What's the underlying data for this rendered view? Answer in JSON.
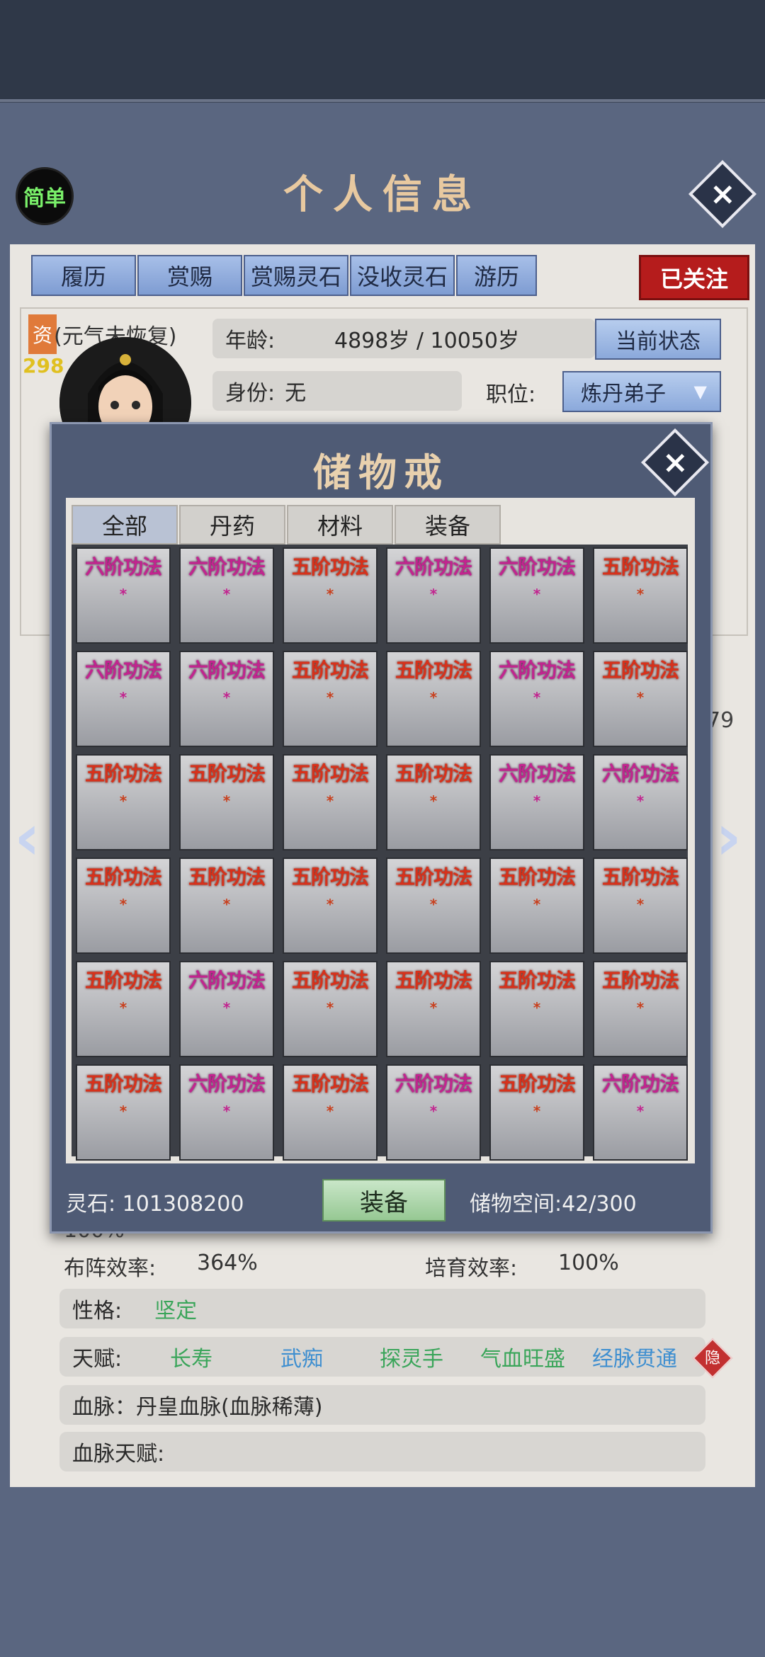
{
  "header": {
    "title": "个人信息",
    "simple_label": "简单"
  },
  "tabs": [
    "履历",
    "赏赐",
    "赏赐灵石",
    "没收灵石",
    "游历"
  ],
  "follow_label": "已关注",
  "profile": {
    "talent_tag": "资",
    "talent_value": "298",
    "status_note": "(元气未恢复)",
    "age_label": "年龄:",
    "age_value": "4898岁 / 10050岁",
    "current_state_button": "当前状态",
    "identity_label": "身份:",
    "identity_value": "无",
    "position_label": "职位:",
    "position_value": "炼丹弟子",
    "partial_value": "79"
  },
  "storage_ring": {
    "title": "储物戒",
    "tabs": [
      "全部",
      "丹药",
      "材料",
      "装备"
    ],
    "active_tab": "全部",
    "grid": [
      [
        "六阶功法",
        "六阶功法",
        "五阶功法",
        "六阶功法",
        "六阶功法",
        "五阶功法"
      ],
      [
        "六阶功法",
        "六阶功法",
        "五阶功法",
        "五阶功法",
        "六阶功法",
        "五阶功法"
      ],
      [
        "五阶功法",
        "五阶功法",
        "五阶功法",
        "五阶功法",
        "六阶功法",
        "六阶功法"
      ],
      [
        "五阶功法",
        "五阶功法",
        "五阶功法",
        "五阶功法",
        "五阶功法",
        "五阶功法"
      ],
      [
        "五阶功法",
        "六阶功法",
        "五阶功法",
        "五阶功法",
        "五阶功法",
        "五阶功法"
      ],
      [
        "五阶功法",
        "六阶功法",
        "五阶功法",
        "六阶功法",
        "五阶功法",
        "六阶功法"
      ]
    ],
    "star": "*",
    "spirit_stone_label": "灵石:",
    "spirit_stone_value": "101308200",
    "equip_button": "装备",
    "space_label": "储物空间:",
    "space_value": "42/300"
  },
  "stats": {
    "formation_label": "布阵效率:",
    "formation_value": "364%",
    "cultivate_label": "培育效率:",
    "cultivate_value": "100%",
    "hidden_left_value": "100%",
    "hidden_right_value": "100%"
  },
  "personality": {
    "label": "性格:",
    "value": "坚定"
  },
  "talents": {
    "label": "天赋:",
    "items": [
      {
        "text": "长寿",
        "color": "#3aa55a"
      },
      {
        "text": "武痴",
        "color": "#3f8fd0"
      },
      {
        "text": "探灵手",
        "color": "#3aa55a"
      },
      {
        "text": "气血旺盛",
        "color": "#3aa55a"
      },
      {
        "text": "经脉贯通",
        "color": "#3f8fd0"
      }
    ],
    "hidden_badge": "隐"
  },
  "bloodline": {
    "text": "血脉：丹皇血脉(血脉稀薄)"
  },
  "bloodline_talent": {
    "label": "血脉天赋:"
  },
  "colors": {
    "tier5": "#d7311b",
    "tier6": "#c2248f",
    "follow": "#b51c1c"
  }
}
